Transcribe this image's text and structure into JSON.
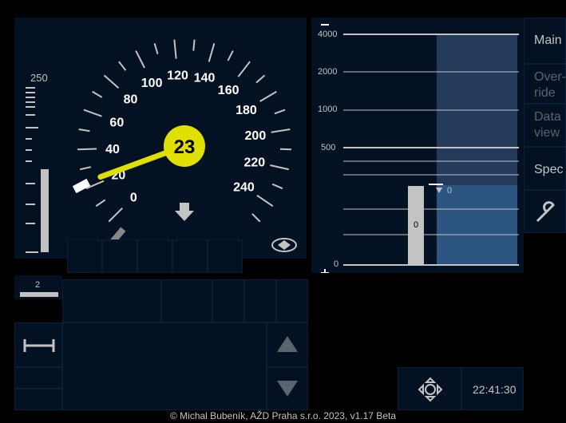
{
  "speedometer": {
    "current_speed": 23,
    "max_speed": 250,
    "permitted_speed": 20,
    "scale_labels": [
      "0",
      "20",
      "40",
      "60",
      "80",
      "100",
      "120",
      "140",
      "160",
      "180",
      "200",
      "220",
      "240"
    ],
    "direction_arrow": "down-arrow-icon"
  },
  "distance_bar": {
    "top_label": "250",
    "target_label": "2"
  },
  "planning": {
    "scale_labels": [
      "4000",
      "2000",
      "1000",
      "500",
      "0"
    ],
    "zoom_out_symbol": "−",
    "zoom_in_symbol": "+",
    "bar_label": "0",
    "marker_label": "0"
  },
  "menu": {
    "main": "Main",
    "override": "Over-ride",
    "data_view": "Data view",
    "special": "Spec",
    "settings_icon": "wrench-icon"
  },
  "level_icon": "level-crossing-icon",
  "mode_icon": "full-supervision-icon",
  "clock": "22:41:30",
  "footer": "© Michal Bubeník, AŽD Praha s.r.o. 2023, v1.17 Beta",
  "colors": {
    "background": "#031122",
    "needle": "#dfdf00",
    "plan_area": "#233a5a",
    "grey": "#c3c3c3"
  }
}
